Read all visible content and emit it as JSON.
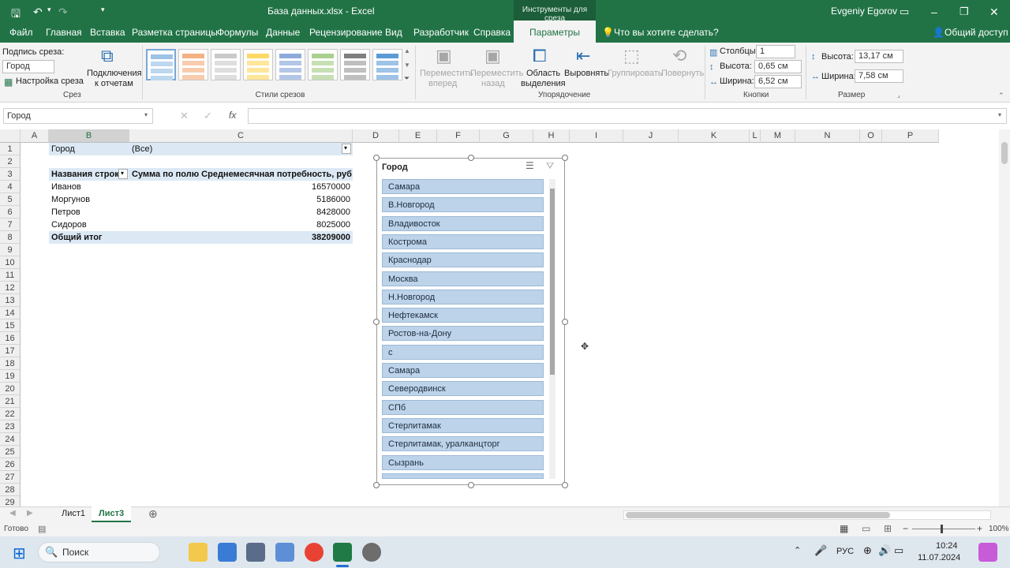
{
  "title": {
    "file": "База данных.xlsx  -  Excel",
    "context_group": "Инструменты для среза",
    "user": "Evgeniy Egorov"
  },
  "tabs": [
    "Файл",
    "Главная",
    "Вставка",
    "Разметка страницы",
    "Формулы",
    "Данные",
    "Рецензирование",
    "Вид",
    "Разработчик",
    "Справка"
  ],
  "context_tab": "Параметры",
  "tell_me": "Что вы хотите сделать?",
  "share": "Общий доступ",
  "ribbon": {
    "caption_label": "Подпись среза:",
    "caption_value": "Город",
    "settings": "Настройка среза",
    "report_conn_1": "Подключения",
    "report_conn_2": "к отчетам",
    "group_slicer": "Срез",
    "group_styles": "Стили срезов",
    "bring_forward_1": "Переместить",
    "bring_forward_2": "вперед",
    "send_back_1": "Переместить",
    "send_back_2": "назад",
    "selection_1": "Область",
    "selection_2": "выделения",
    "align": "Выровнять",
    "group": "Группировать",
    "rotate": "Повернуть",
    "group_arrange": "Упорядочение",
    "columns_label": "Столбцы:",
    "columns_value": "1",
    "height_label": "Высота:",
    "height_value": "0,65 см",
    "width_label": "Ширина:",
    "width_value": "6,52 см",
    "group_buttons": "Кнопки",
    "size_height_label": "Высота:",
    "size_height_value": "13,17 см",
    "size_width_label": "Ширина:",
    "size_width_value": "7,58 см",
    "group_size": "Размер"
  },
  "formula": {
    "namebox": "Город",
    "fx": "fx"
  },
  "columns": [
    "A",
    "B",
    "C",
    "D",
    "E",
    "F",
    "G",
    "H",
    "I",
    "J",
    "K",
    "L",
    "M",
    "N",
    "O",
    "P"
  ],
  "rows": [
    "1",
    "2",
    "3",
    "4",
    "5",
    "6",
    "7",
    "8",
    "9",
    "10",
    "11",
    "12",
    "13",
    "14",
    "15",
    "16",
    "17",
    "18",
    "19",
    "20",
    "21",
    "22",
    "23",
    "24",
    "25",
    "26",
    "27",
    "28",
    "29"
  ],
  "pivot": {
    "filter_label": "Город",
    "filter_value": "(Все)",
    "hdr_rows": "Названия строк",
    "hdr_sum": "Сумма по полю Среднемесячная потребность, руб",
    "items": [
      {
        "name": "Иванов",
        "value": "16570000"
      },
      {
        "name": "Моргунов",
        "value": "5186000"
      },
      {
        "name": "Петров",
        "value": "8428000"
      },
      {
        "name": "Сидоров",
        "value": "8025000"
      }
    ],
    "total_label": "Общий итог",
    "total_value": "38209000"
  },
  "slicer": {
    "title": "Город",
    "items": [
      "Самара",
      "В.Новгород",
      "Владивосток",
      "Кострома",
      "Краснодар",
      "Москва",
      "Н.Новгород",
      "Нефтекамск",
      "Ростов-на-Дону",
      "с",
      "Самара",
      "Северодвинск",
      "СПб",
      "Стерлитамак",
      "Стерлитамак, уралканцторг",
      "Сызрань"
    ]
  },
  "sheets": [
    "Лист1",
    "Лист3"
  ],
  "status": {
    "ready": "Готово",
    "zoom": "100%"
  },
  "taskbar": {
    "search": "Поиск",
    "lang": "РУС",
    "time": "10:24",
    "date": "11.07.2024"
  }
}
